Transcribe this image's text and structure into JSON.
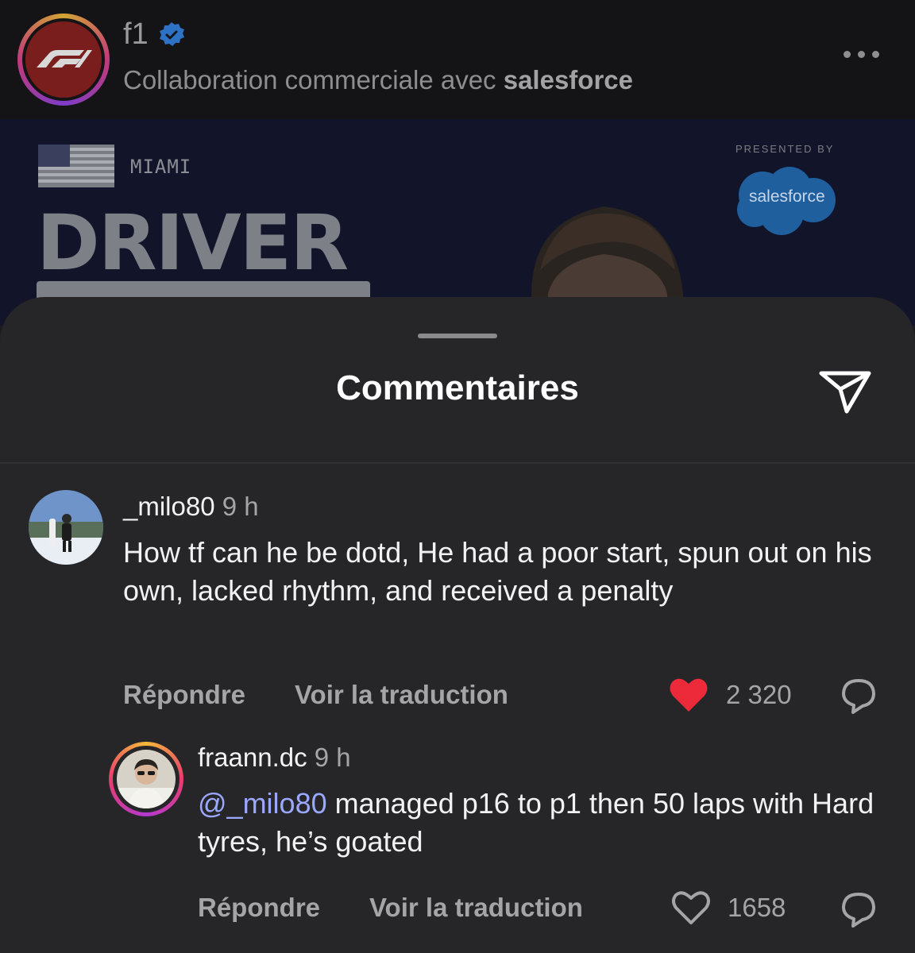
{
  "post_header": {
    "username": "f1",
    "subtitle_prefix": "Collaboration commerciale avec",
    "subtitle_partner": "salesforce",
    "more_icon": "ellipsis-icon"
  },
  "media": {
    "city": "MIAMI",
    "title": "DRIVER",
    "presented_by": "PRESENTED BY",
    "sponsor": "salesforce"
  },
  "sheet": {
    "title": "Commentaires",
    "share_icon": "paper-plane-icon"
  },
  "comments": [
    {
      "username": "_milo80",
      "time": "9 h",
      "text": "How tf can he be dotd, He had a poor start, spun out on his own, lacked rhythm, and received a penalty",
      "reply_label": "Répondre",
      "translate_label": "Voir la traduction",
      "likes": "2 320",
      "liked": true,
      "like_color": "#ed2a3a"
    },
    {
      "username": "fraann.dc",
      "time": "9 h",
      "mention": "@_milo80",
      "text": " managed p16 to p1 then 50 laps with Hard tyres, he’s goated",
      "reply_label": "Répondre",
      "translate_label": "Voir la traduction",
      "likes": "1658",
      "liked": false
    }
  ]
}
